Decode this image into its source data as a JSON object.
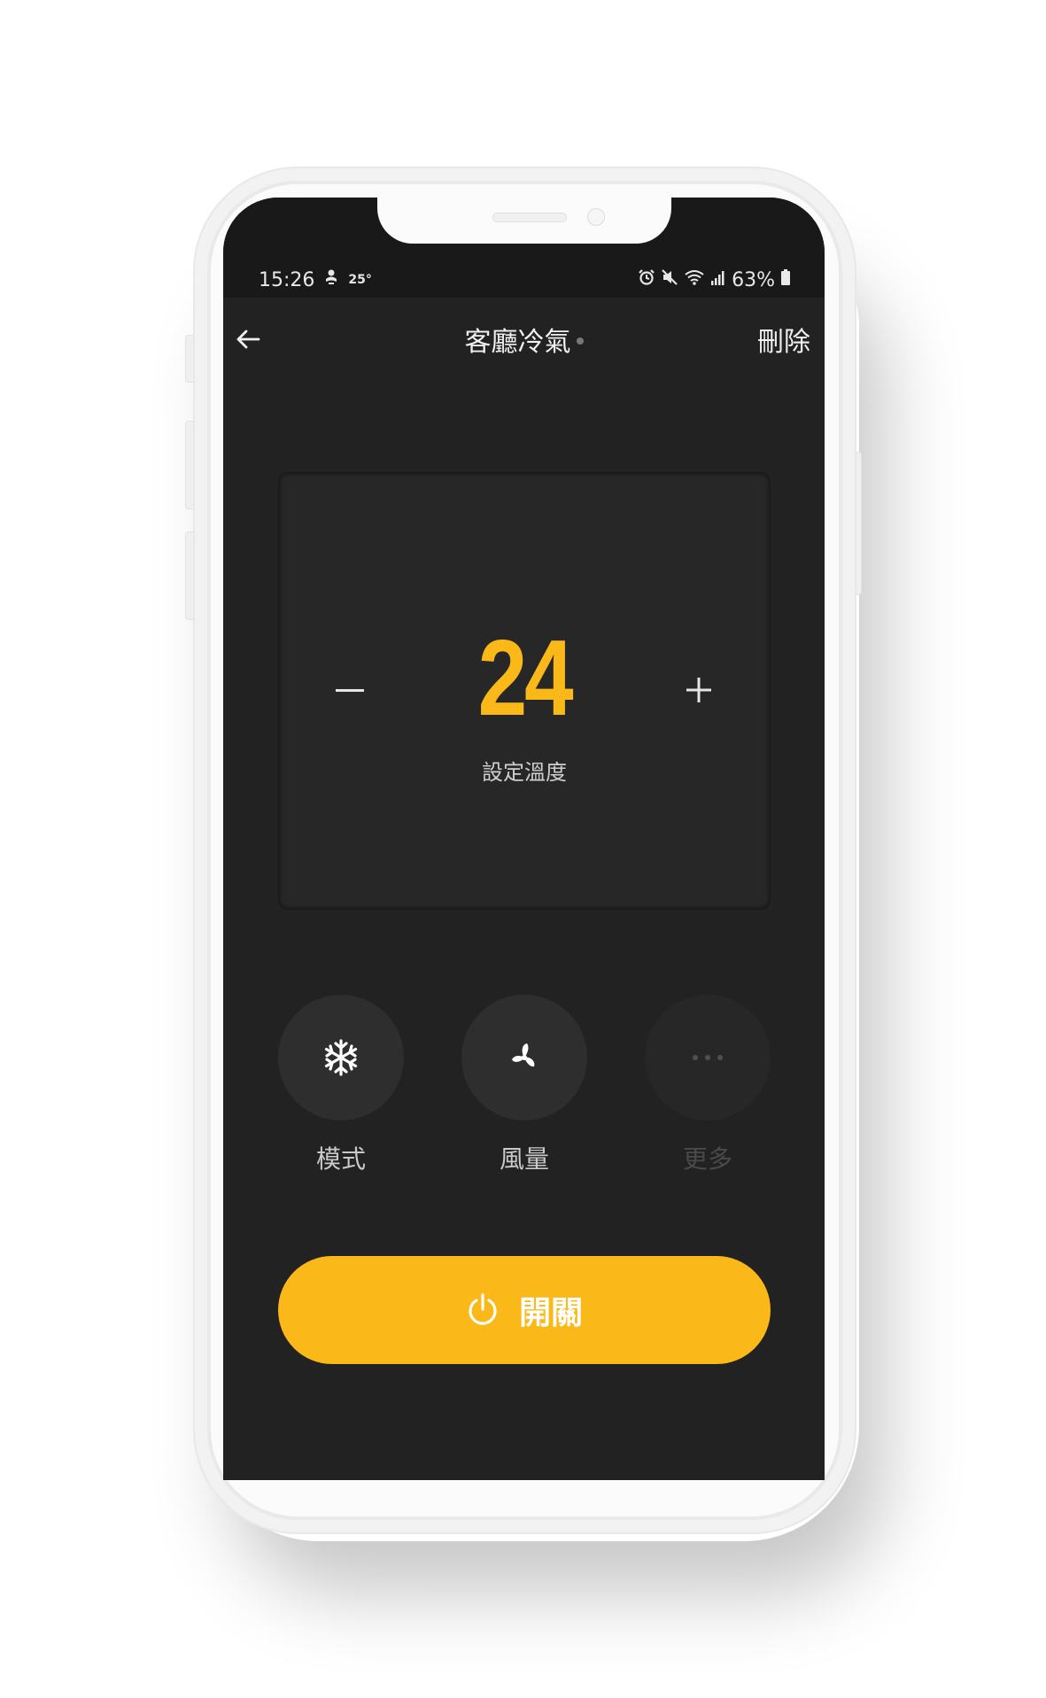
{
  "status_bar": {
    "time": "15:26",
    "weather_temp": "25°",
    "battery": "63%"
  },
  "header": {
    "title": "客廳冷氣",
    "delete_label": "刪除"
  },
  "thermostat": {
    "set_temperature": "24",
    "label": "設定溫度"
  },
  "controls": [
    {
      "label": "模式",
      "icon": "snowflake-icon",
      "enabled": true
    },
    {
      "label": "風量",
      "icon": "fan-icon",
      "enabled": true
    },
    {
      "label": "更多",
      "icon": "more-icon",
      "enabled": false
    }
  ],
  "power": {
    "label": "開關"
  },
  "colors": {
    "accent": "#fbb919",
    "screen_bg": "#222222",
    "panel_bg": "#272727"
  }
}
